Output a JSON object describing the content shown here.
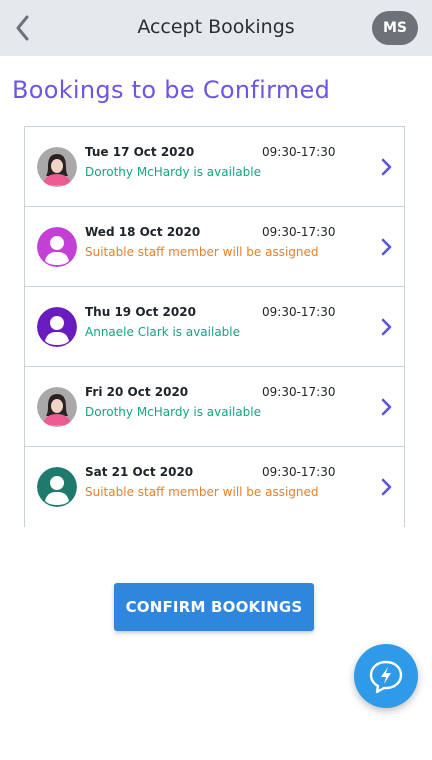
{
  "header": {
    "title": "Accept Bookings",
    "user_initials": "MS"
  },
  "page": {
    "heading": "Bookings to be Confirmed"
  },
  "bookings": [
    {
      "date": "Tue 17 Oct 2020",
      "time": "09:30-17:30",
      "status": "Dorothy McHardy is available",
      "status_type": "available",
      "avatar": "woman-avatar-icon"
    },
    {
      "date": "Wed 18 Oct 2020",
      "time": "09:30-17:30",
      "status": "Suitable staff member will be assigned",
      "status_type": "pending",
      "avatar": "person-avatar-icon"
    },
    {
      "date": "Thu 19 Oct 2020",
      "time": "09:30-17:30",
      "status": "Annaele Clark is available",
      "status_type": "available",
      "avatar": "person-avatar-icon"
    },
    {
      "date": "Fri 20 Oct 2020",
      "time": "09:30-17:30",
      "status": "Dorothy McHardy is available",
      "status_type": "available",
      "avatar": "woman-avatar-icon"
    },
    {
      "date": "Sat 21 Oct 2020",
      "time": "09:30-17:30",
      "status": "Suitable staff member will be assigned",
      "status_type": "pending",
      "avatar": "person-avatar-icon"
    }
  ],
  "actions": {
    "confirm_label": "CONFIRM BOOKINGS"
  },
  "colors": {
    "accent": "#6b57e4",
    "primary_button": "#2f86dd",
    "available": "#15a287",
    "pending": "#e3812d",
    "fab": "#2f9be8",
    "avatar_bgs": [
      "#a9a9a9",
      "#c43fd6",
      "#6a1bbd",
      "#a9a9a9",
      "#1e7a6c"
    ]
  }
}
